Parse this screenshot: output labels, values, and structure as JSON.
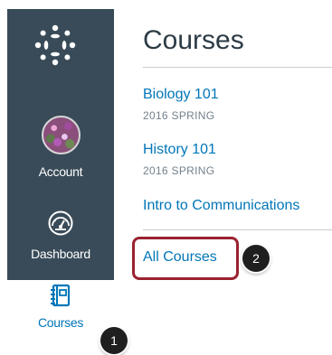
{
  "sidebar": {
    "logo_icon": "canvas-logo-icon",
    "items": [
      {
        "id": "account",
        "label": "Account",
        "icon": "avatar"
      },
      {
        "id": "dashboard",
        "label": "Dashboard",
        "icon": "dashboard-gauge-icon"
      },
      {
        "id": "courses",
        "label": "Courses",
        "icon": "courses-book-icon",
        "active": true
      }
    ]
  },
  "tray": {
    "title": "Courses",
    "courses": [
      {
        "name": "Biology 101",
        "term": "2016 SPRING"
      },
      {
        "name": "History 101",
        "term": "2016 SPRING"
      },
      {
        "name": "Intro to Communications",
        "term": ""
      }
    ],
    "all_courses_label": "All Courses"
  },
  "callouts": [
    "1",
    "2"
  ],
  "colors": {
    "sidebar_bg": "#394b58",
    "link": "#0076b8",
    "highlight_border": "#9a2230",
    "callout_bg": "#1f1f1f"
  }
}
